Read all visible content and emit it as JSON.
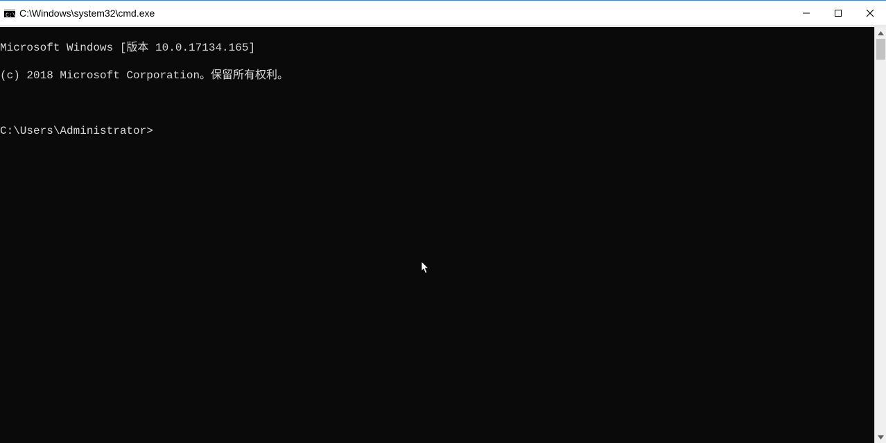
{
  "window": {
    "title": "C:\\Windows\\system32\\cmd.exe"
  },
  "console": {
    "line1": "Microsoft Windows [版本 10.0.17134.165]",
    "line2": "(c) 2018 Microsoft Corporation。保留所有权利。",
    "blank": "",
    "prompt": "C:\\Users\\Administrator>"
  }
}
